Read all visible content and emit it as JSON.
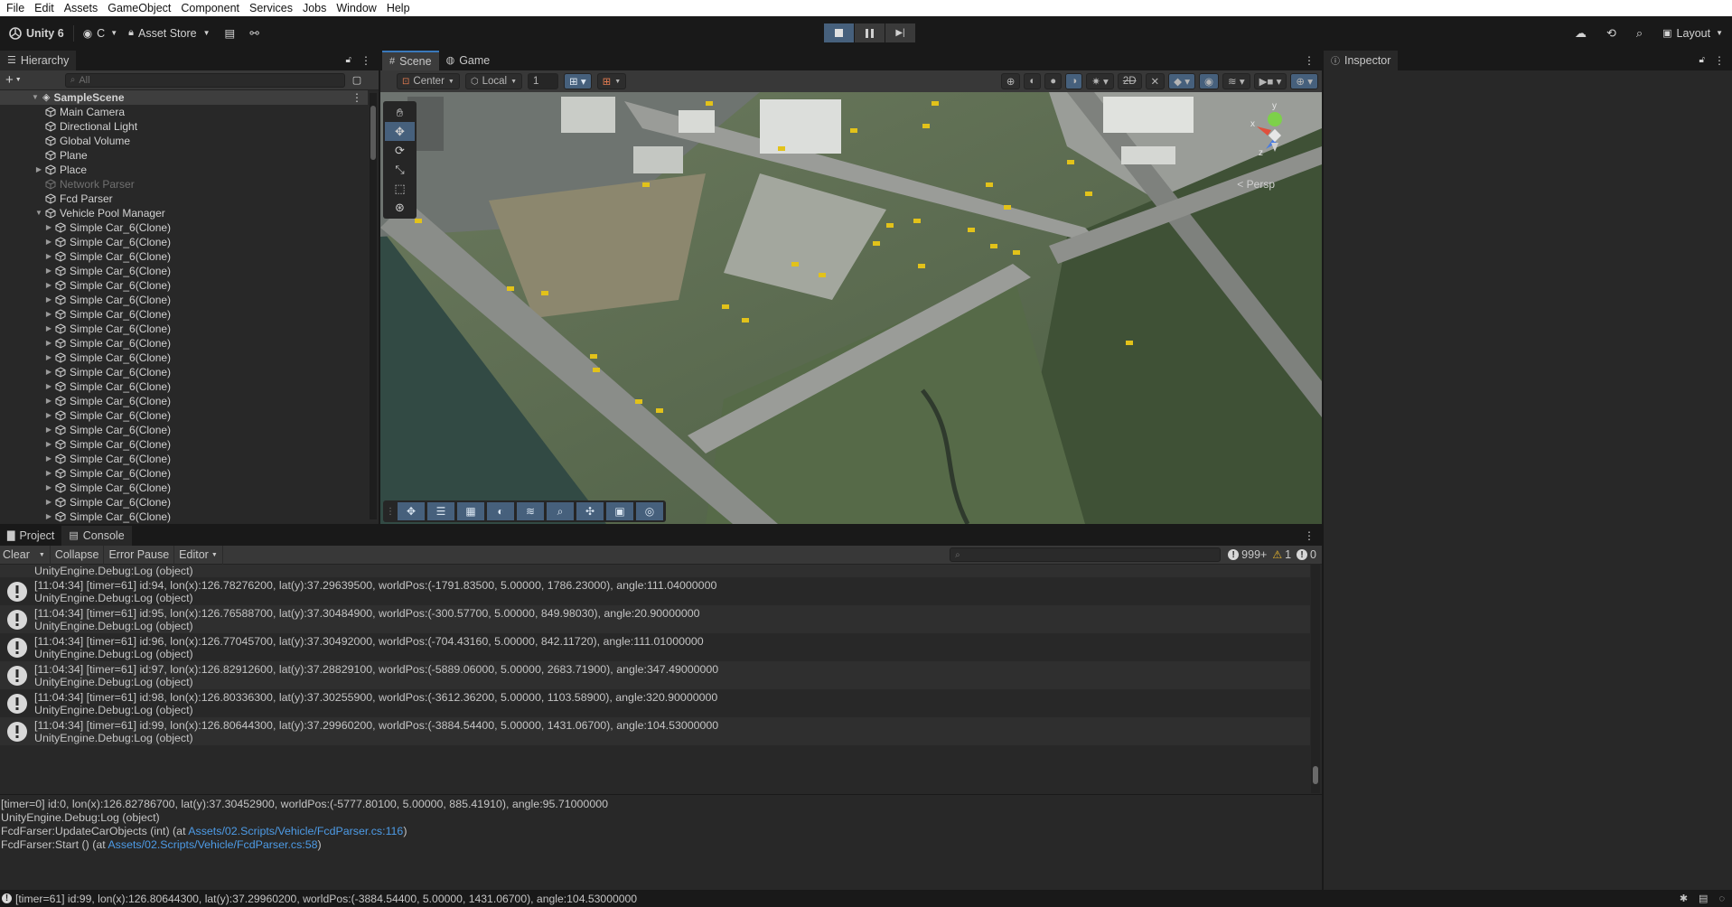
{
  "menu": [
    "File",
    "Edit",
    "Assets",
    "GameObject",
    "Component",
    "Services",
    "Jobs",
    "Window",
    "Help"
  ],
  "toolbar": {
    "app_label": "Unity 6",
    "account_label": "C",
    "asset_store_label": "Asset Store",
    "layout_label": "Layout"
  },
  "hierarchy": {
    "tab_label": "Hierarchy",
    "search_placeholder": "All",
    "scene_name": "SampleScene",
    "items": [
      {
        "label": "Main Camera",
        "depth": 1,
        "arrow": false,
        "dim": false
      },
      {
        "label": "Directional Light",
        "depth": 1,
        "arrow": false,
        "dim": false
      },
      {
        "label": "Global Volume",
        "depth": 1,
        "arrow": false,
        "dim": false
      },
      {
        "label": "Plane",
        "depth": 1,
        "arrow": false,
        "dim": false
      },
      {
        "label": "Place",
        "depth": 1,
        "arrow": true,
        "dim": false
      },
      {
        "label": "Network Parser",
        "depth": 1,
        "arrow": false,
        "dim": true
      },
      {
        "label": "Fcd Parser",
        "depth": 1,
        "arrow": false,
        "dim": false
      },
      {
        "label": "Vehicle Pool Manager",
        "depth": 1,
        "arrow": true,
        "open": true,
        "dim": false
      },
      {
        "label": "Simple Car_6(Clone)",
        "depth": 2,
        "arrow": true,
        "dim": false
      },
      {
        "label": "Simple Car_6(Clone)",
        "depth": 2,
        "arrow": true,
        "dim": false
      },
      {
        "label": "Simple Car_6(Clone)",
        "depth": 2,
        "arrow": true,
        "dim": false
      },
      {
        "label": "Simple Car_6(Clone)",
        "depth": 2,
        "arrow": true,
        "dim": false
      },
      {
        "label": "Simple Car_6(Clone)",
        "depth": 2,
        "arrow": true,
        "dim": false
      },
      {
        "label": "Simple Car_6(Clone)",
        "depth": 2,
        "arrow": true,
        "dim": false
      },
      {
        "label": "Simple Car_6(Clone)",
        "depth": 2,
        "arrow": true,
        "dim": false
      },
      {
        "label": "Simple Car_6(Clone)",
        "depth": 2,
        "arrow": true,
        "dim": false
      },
      {
        "label": "Simple Car_6(Clone)",
        "depth": 2,
        "arrow": true,
        "dim": false
      },
      {
        "label": "Simple Car_6(Clone)",
        "depth": 2,
        "arrow": true,
        "dim": false
      },
      {
        "label": "Simple Car_6(Clone)",
        "depth": 2,
        "arrow": true,
        "dim": false
      },
      {
        "label": "Simple Car_6(Clone)",
        "depth": 2,
        "arrow": true,
        "dim": false
      },
      {
        "label": "Simple Car_6(Clone)",
        "depth": 2,
        "arrow": true,
        "dim": false
      },
      {
        "label": "Simple Car_6(Clone)",
        "depth": 2,
        "arrow": true,
        "dim": false
      },
      {
        "label": "Simple Car_6(Clone)",
        "depth": 2,
        "arrow": true,
        "dim": false
      },
      {
        "label": "Simple Car_6(Clone)",
        "depth": 2,
        "arrow": true,
        "dim": false
      },
      {
        "label": "Simple Car_6(Clone)",
        "depth": 2,
        "arrow": true,
        "dim": false
      },
      {
        "label": "Simple Car_6(Clone)",
        "depth": 2,
        "arrow": true,
        "dim": false
      },
      {
        "label": "Simple Car_6(Clone)",
        "depth": 2,
        "arrow": true,
        "dim": false
      },
      {
        "label": "Simple Car_6(Clone)",
        "depth": 2,
        "arrow": true,
        "dim": false
      },
      {
        "label": "Simple Car_6(Clone)",
        "depth": 2,
        "arrow": true,
        "dim": false
      },
      {
        "label": "Simple Car_6(Clone)",
        "depth": 2,
        "arrow": true,
        "dim": false
      },
      {
        "label": "Simple Car_6(Clone)",
        "depth": 2,
        "arrow": true,
        "dim": false
      }
    ]
  },
  "scene": {
    "tabs": [
      "Scene",
      "Game"
    ],
    "pivot_label": "Center",
    "space_label": "Local",
    "grid_value": "1",
    "toggle_2d": "2D",
    "persp_label": "Persp",
    "axis_x": "x",
    "axis_y": "y",
    "axis_z": "z"
  },
  "inspector": {
    "tab_label": "Inspector"
  },
  "bottom": {
    "tabs": [
      "Project",
      "Console"
    ],
    "console": {
      "clear_label": "Clear",
      "collapse_label": "Collapse",
      "error_pause_label": "Error Pause",
      "editor_label": "Editor",
      "log_count": "999+",
      "warn_count": "1",
      "error_count": "0",
      "partial_line": "UnityEngine.Debug:Log (object)",
      "entries": [
        {
          "line1": "[11:04:34] [timer=61] id:94, lon(x):126.78276200, lat(y):37.29639500, worldPos:(-1791.83500, 5.00000, 1786.23000), angle:111.04000000",
          "line2": "UnityEngine.Debug:Log (object)"
        },
        {
          "line1": "[11:04:34] [timer=61] id:95, lon(x):126.76588700, lat(y):37.30484900, worldPos:(-300.57700, 5.00000, 849.98030), angle:20.90000000",
          "line2": "UnityEngine.Debug:Log (object)"
        },
        {
          "line1": "[11:04:34] [timer=61] id:96, lon(x):126.77045700, lat(y):37.30492000, worldPos:(-704.43160, 5.00000, 842.11720), angle:111.01000000",
          "line2": "UnityEngine.Debug:Log (object)"
        },
        {
          "line1": "[11:04:34] [timer=61] id:97, lon(x):126.82912600, lat(y):37.28829100, worldPos:(-5889.06000, 5.00000, 2683.71900), angle:347.49000000",
          "line2": "UnityEngine.Debug:Log (object)"
        },
        {
          "line1": "[11:04:34] [timer=61] id:98, lon(x):126.80336300, lat(y):37.30255900, worldPos:(-3612.36200, 5.00000, 1103.58900), angle:320.90000000",
          "line2": "UnityEngine.Debug:Log (object)"
        },
        {
          "line1": "[11:04:34] [timer=61] id:99, lon(x):126.80644300, lat(y):37.29960200, worldPos:(-3884.54400, 5.00000, 1431.06700), angle:104.53000000",
          "line2": "UnityEngine.Debug:Log (object)"
        }
      ],
      "detail": {
        "line1": "[timer=0] id:0, lon(x):126.82786700, lat(y):37.30452900, worldPos:(-5777.80100, 5.00000, 885.41910), angle:95.71000000",
        "line2": "UnityEngine.Debug:Log (object)",
        "line3_prefix": "FcdFarser:UpdateCarObjects (int) (at ",
        "line3_link": "Assets/02.Scripts/Vehicle/FcdParser.cs:116",
        "line3_suffix": ")",
        "line4_prefix": "FcdFarser:Start () (at ",
        "line4_link": "Assets/02.Scripts/Vehicle/FcdParser.cs:58",
        "line4_suffix": ")"
      }
    }
  },
  "statusbar": {
    "message": "[timer=61] id:99, lon(x):126.80644300, lat(y):37.29960200, worldPos:(-3884.54400, 5.00000, 1431.06700), angle:104.53000000"
  }
}
